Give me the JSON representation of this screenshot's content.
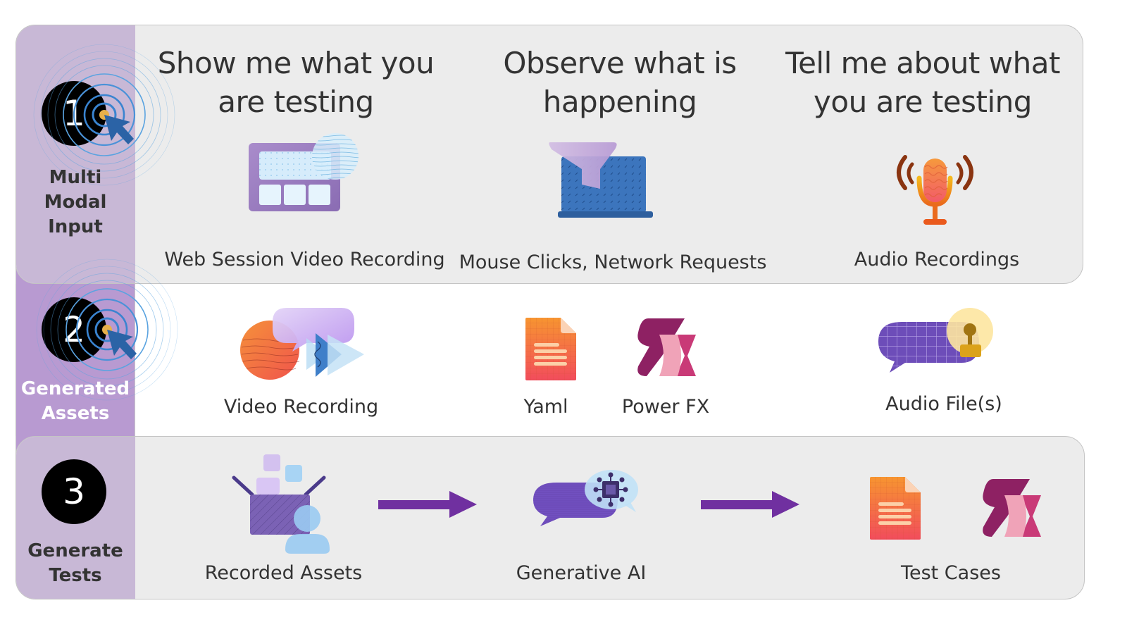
{
  "steps": [
    {
      "number": "1",
      "label_lines": [
        "Multi",
        "Modal",
        "Input"
      ],
      "label_color": "#333333",
      "columns": [
        {
          "heading_lines": [
            "Show me what you",
            "are testing"
          ],
          "icon": "web-session-window-icon",
          "caption": "Web Session Video Recording"
        },
        {
          "heading_lines": [
            "Observe what is",
            "happening"
          ],
          "icon": "laptop-funnel-icon",
          "caption": "Mouse Clicks, Network Requests"
        },
        {
          "heading_lines": [
            "Tell me about what",
            "you are testing"
          ],
          "icon": "microphone-icon",
          "caption": "Audio Recordings"
        }
      ]
    },
    {
      "number": "2",
      "label_lines": [
        "Generated",
        "Assets"
      ],
      "label_color": "#ffffff",
      "items": [
        {
          "icon": "video-chat-play-icon",
          "caption": "Video Recording"
        },
        {
          "icon": "yaml-document-icon",
          "caption": "Yaml"
        },
        {
          "icon": "power-fx-icon",
          "caption": "Power FX"
        },
        {
          "icon": "audio-chat-bulb-icon",
          "caption": "Audio File(s)"
        }
      ]
    },
    {
      "number": "3",
      "label_lines": [
        "Generate",
        "Tests"
      ],
      "label_color": "#333333",
      "items": [
        {
          "icon": "recorded-assets-box-icon",
          "caption": "Recorded Assets"
        },
        {
          "icon": "generative-ai-chip-icon",
          "caption": "Generative AI"
        },
        {
          "icon": "test-cases-icons",
          "caption": "Test Cases"
        }
      ],
      "flow_arrows": 2
    }
  ],
  "colors": {
    "sidebar_purple": "#b89ad1",
    "sidebar_tint": "#c8b8d6",
    "panel_gray": "#ececec",
    "arrow_purple": "#7030a0",
    "badge_black": "#000000"
  }
}
